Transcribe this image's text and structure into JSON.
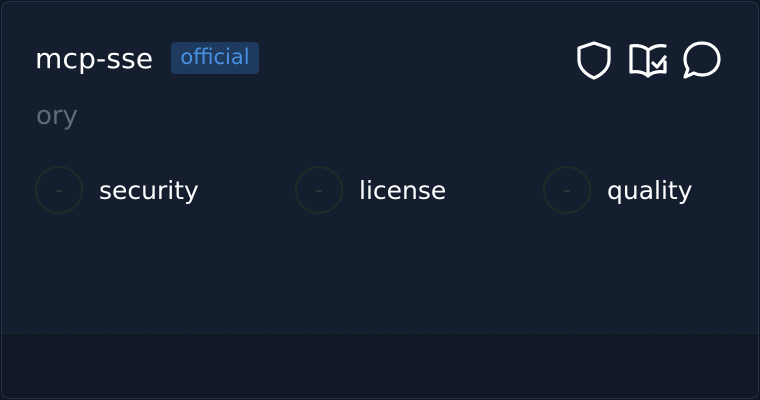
{
  "card": {
    "name": "mcp-sse",
    "badge": "official",
    "owner": "ory"
  },
  "actions": [
    {
      "icon": "shield-icon"
    },
    {
      "icon": "book-check-icon"
    },
    {
      "icon": "chat-bubble-icon"
    }
  ],
  "metrics": [
    {
      "value": "-",
      "label": "security"
    },
    {
      "value": "-",
      "label": "license"
    },
    {
      "value": "-",
      "label": "quality"
    }
  ],
  "colors": {
    "background": "#151e2f",
    "badge_bg": "#1f3a5f",
    "badge_text": "#4a90e2",
    "owner_text": "#5d6b78",
    "text": "#ffffff"
  }
}
